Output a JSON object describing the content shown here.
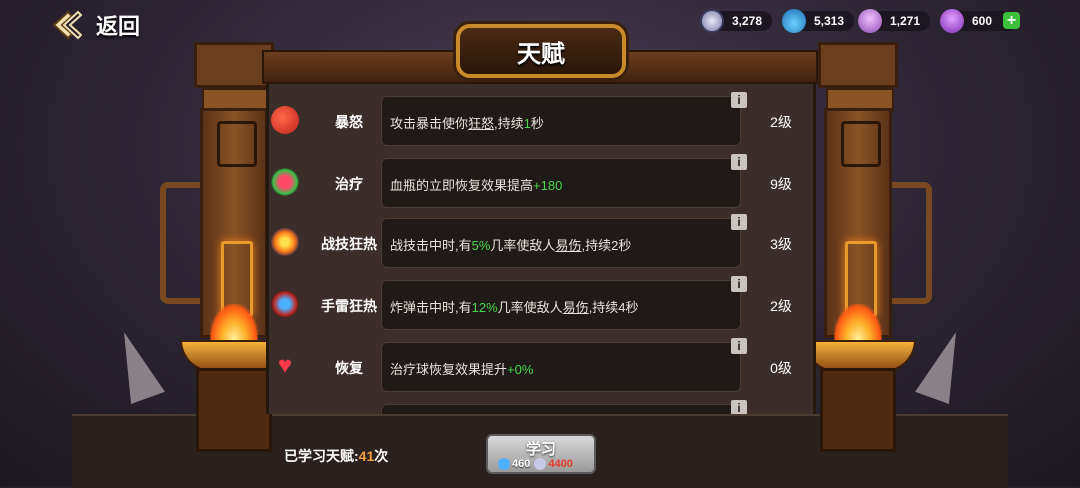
{
  "header": {
    "back_label": "返回",
    "title": "天赋"
  },
  "resources": [
    {
      "icon": "silver-coin-icon",
      "value": "3,278"
    },
    {
      "icon": "blue-potion-icon",
      "value": "5,313"
    },
    {
      "icon": "locked-gem-icon",
      "value": "1,271"
    },
    {
      "icon": "purple-gem-icon",
      "value": "600"
    }
  ],
  "talents": [
    {
      "icon": "angry-face-icon",
      "name": "暴怒",
      "level": "2级",
      "desc": {
        "pre": "攻击暴击使你",
        "u": "狂怒",
        "mid": ",持续",
        "g": "1",
        "post": "秒"
      }
    },
    {
      "icon": "healing-bottle-icon",
      "name": "治疗",
      "level": "9级",
      "desc": {
        "pre": "血瓶的立即恢复效果提高",
        "g": "+180"
      }
    },
    {
      "icon": "combat-burst-icon",
      "name": "战技狂热",
      "level": "3级",
      "desc": {
        "pre": "战技击中时,有",
        "g": "5%",
        "mid": "几率使敌人",
        "u": "易伤",
        "post": ",持续2秒"
      }
    },
    {
      "icon": "grenade-icon",
      "name": "手雷狂热",
      "level": "2级",
      "desc": {
        "pre": "炸弹击中时,有",
        "g": "12%",
        "mid": "几率使敌人",
        "u": "易伤",
        "post": ",持续4秒"
      }
    },
    {
      "icon": "heart-icon",
      "name": "恢复",
      "level": "0级",
      "desc": {
        "pre": "治疗球恢复效果提升",
        "g": "+0%"
      }
    }
  ],
  "footer": {
    "learned_label": "已学习天赋:",
    "learned_count": "41",
    "learned_suffix": "次",
    "learn_button": "学习",
    "cost_potion": "460",
    "cost_coin": "4400"
  },
  "colors": {
    "highlight": "#4ad64a",
    "cost_red": "#e83a2a",
    "title_border": "#c98a2a"
  }
}
